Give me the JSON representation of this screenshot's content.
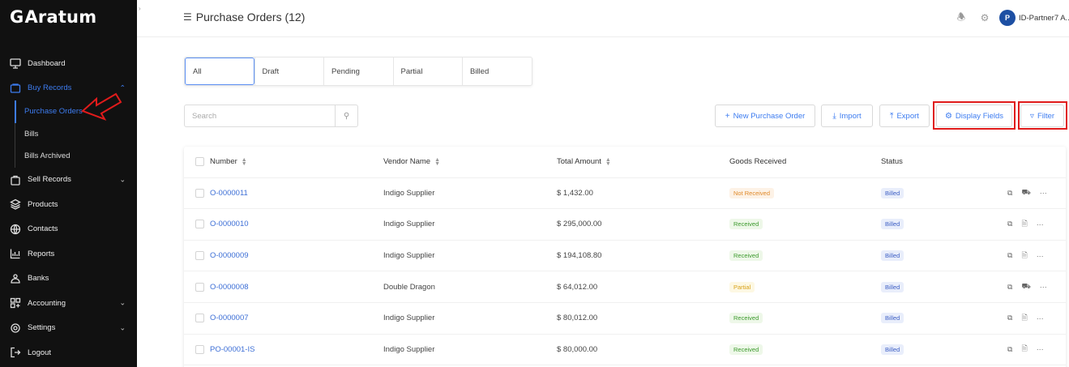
{
  "brand": {
    "name": "Aratum",
    "logo_mark": "G"
  },
  "sidebar": {
    "items": [
      {
        "label": "Dashboard",
        "icon": "monitor-icon"
      },
      {
        "label": "Buy Records",
        "icon": "cart-icon",
        "active": true,
        "expanded": true,
        "children": [
          {
            "label": "Purchase Orders",
            "active": true
          },
          {
            "label": "Bills"
          },
          {
            "label": "Bills Archived"
          }
        ]
      },
      {
        "label": "Sell Records",
        "icon": "bag-icon"
      },
      {
        "label": "Products",
        "icon": "layers-icon"
      },
      {
        "label": "Contacts",
        "icon": "globe-icon"
      },
      {
        "label": "Reports",
        "icon": "chart-icon"
      },
      {
        "label": "Banks",
        "icon": "bank-icon"
      },
      {
        "label": "Accounting",
        "icon": "grid-icon"
      },
      {
        "label": "Settings",
        "icon": "gear-icon"
      },
      {
        "label": "Logout",
        "icon": "logout-icon"
      }
    ]
  },
  "header": {
    "title": "Purchase Orders (12)",
    "user_name": "ID-Partner7 A...",
    "avatar_letter": "P"
  },
  "tabs": [
    "All",
    "Draft",
    "Pending",
    "Partial",
    "Billed"
  ],
  "search": {
    "placeholder": "Search"
  },
  "toolbar": {
    "new_label": "New Purchase Order",
    "import_label": "Import",
    "export_label": "Export",
    "display_fields_label": "Display Fields",
    "filter_label": "Filter"
  },
  "table": {
    "headers": {
      "number": "Number",
      "vendor": "Vendor Name",
      "total": "Total Amount",
      "goods": "Goods Received",
      "status": "Status"
    },
    "rows": [
      {
        "number": "O-0000011",
        "vendor": "Indigo Supplier",
        "total": "$ 1,432.00",
        "goods": "Not Received",
        "status": "Billed"
      },
      {
        "number": "O-0000010",
        "vendor": "Indigo Supplier",
        "total": "$ 295,000.00",
        "goods": "Received",
        "status": "Billed"
      },
      {
        "number": "O-0000009",
        "vendor": "Indigo Supplier",
        "total": "$ 194,108.80",
        "goods": "Received",
        "status": "Billed"
      },
      {
        "number": "O-0000008",
        "vendor": "Double Dragon",
        "total": "$ 64,012.00",
        "goods": "Partial",
        "status": "Billed"
      },
      {
        "number": "O-0000007",
        "vendor": "Indigo Supplier",
        "total": "$ 80,012.00",
        "goods": "Received",
        "status": "Billed"
      },
      {
        "number": "PO-00001-IS",
        "vendor": "Indigo Supplier",
        "total": "$ 80,000.00",
        "goods": "Received",
        "status": "Billed"
      }
    ]
  },
  "colors": {
    "accent": "#3d7cf0",
    "sidebar_bg": "#111111",
    "highlight": "#e01b1b"
  }
}
